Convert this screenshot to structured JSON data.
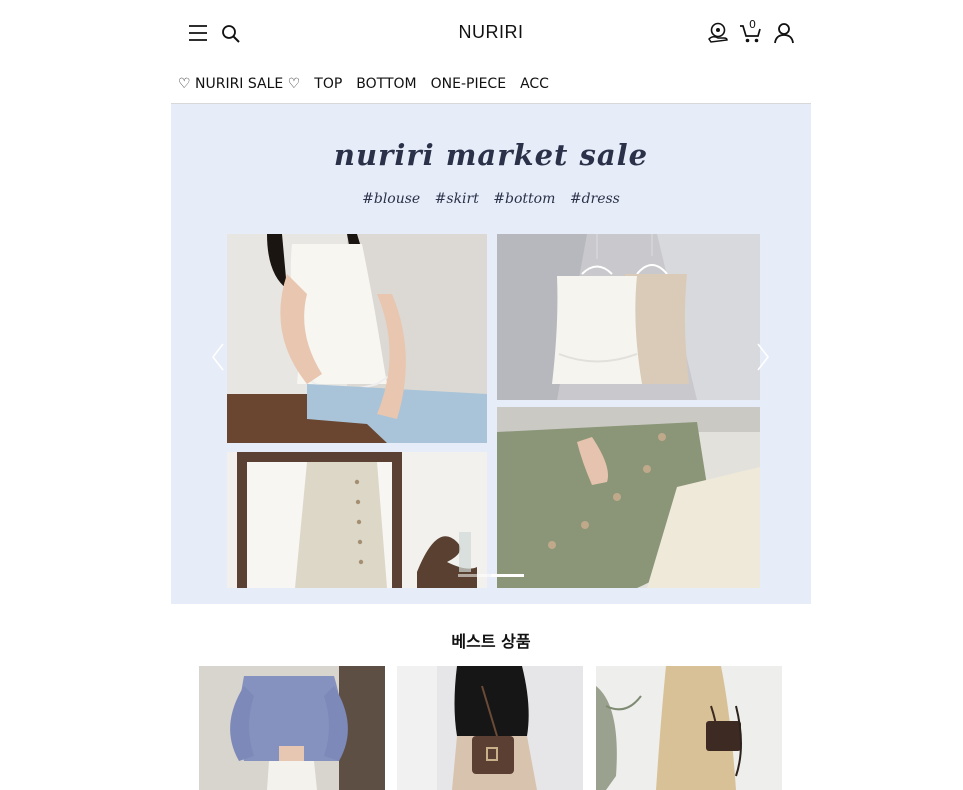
{
  "header": {
    "logo": "NURIRI",
    "cart_count": "0",
    "icons": [
      "menu-icon",
      "search-icon",
      "mileage-icon",
      "cart-icon",
      "user-icon"
    ]
  },
  "nav": {
    "items": [
      "♡ NURIRI SALE ♡",
      "TOP",
      "BOTTOM",
      "ONE-PIECE",
      "ACC"
    ]
  },
  "banner": {
    "title": "nuriri market sale",
    "hashtags": "#blouse #skirt #bottom #dress",
    "background": "#e7edf8",
    "slide_count": 2,
    "active_slide": 2
  },
  "best": {
    "title": "베스트 상품"
  },
  "colors": {
    "title_text": "#2a3148",
    "banner_bg": "#e7edf8"
  }
}
